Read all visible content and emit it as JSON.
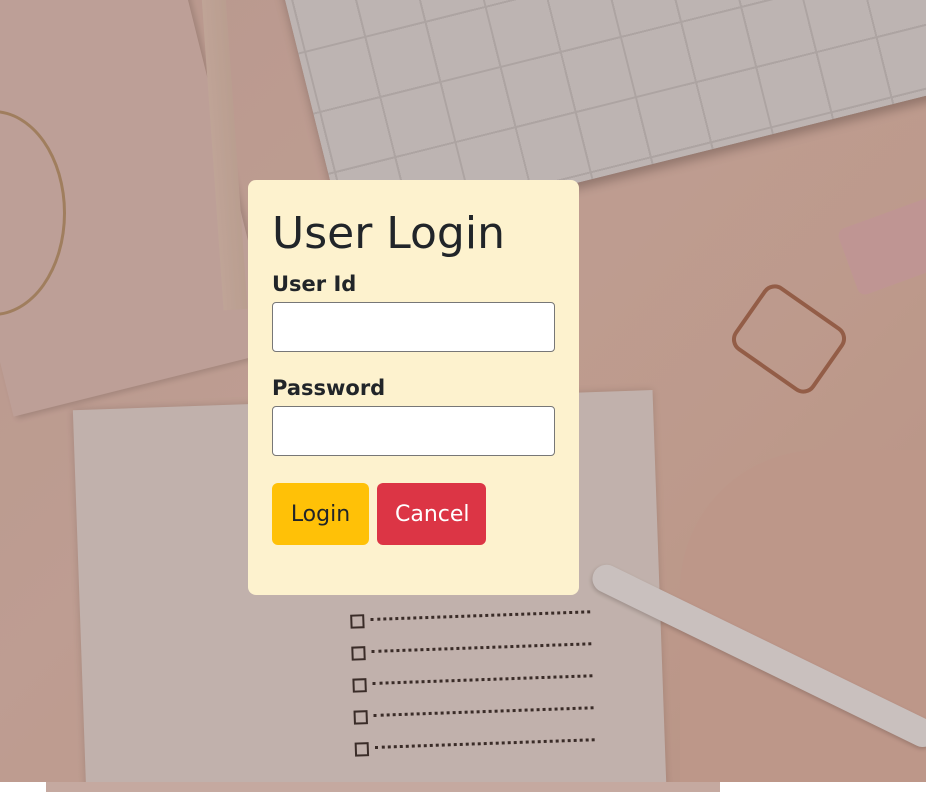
{
  "login_form": {
    "title": "User Login",
    "user_id_label": "User Id",
    "user_id_value": "",
    "password_label": "Password",
    "password_value": "",
    "login_button": "Login",
    "cancel_button": "Cancel"
  },
  "colors": {
    "card_background": "#fdf2ce",
    "login_button": "#ffc107",
    "cancel_button": "#dc3545"
  }
}
